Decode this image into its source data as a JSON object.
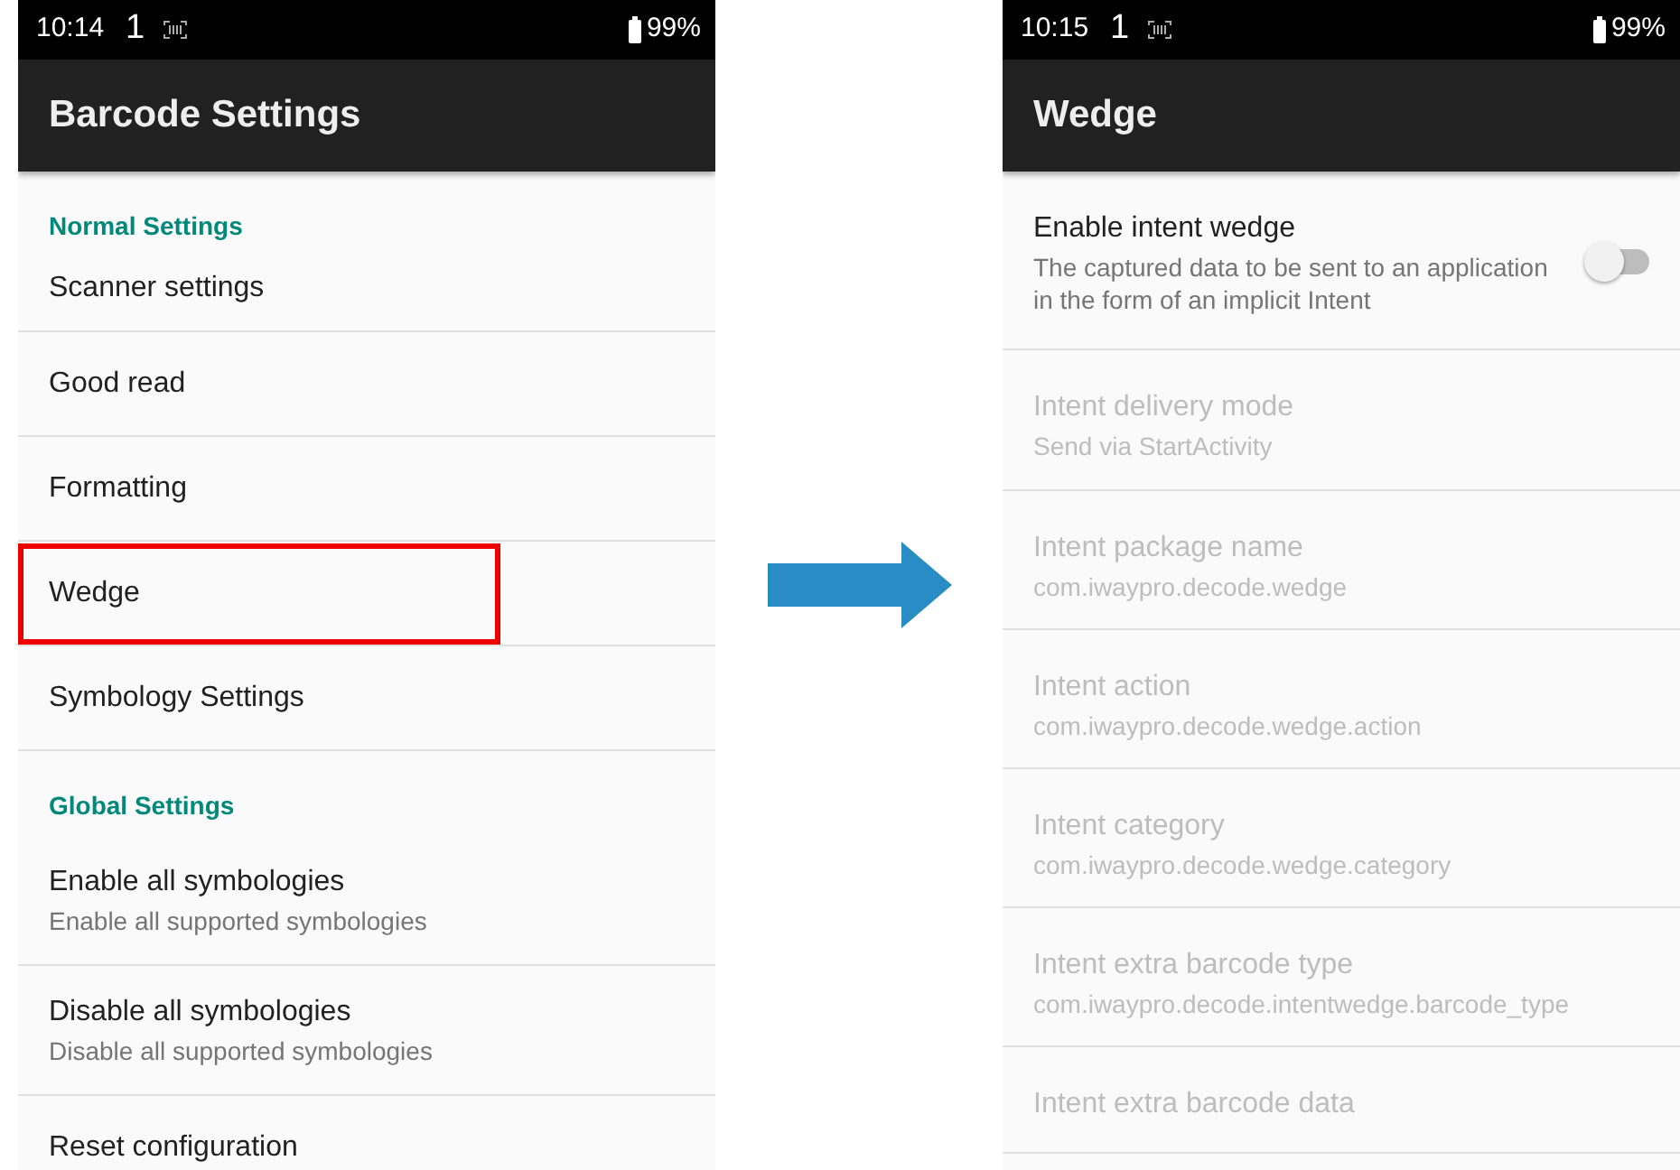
{
  "screens": [
    {
      "status_bar": {
        "time": "10:14",
        "sim": "1",
        "battery": "99%"
      },
      "title": "Barcode Settings",
      "sections": [
        {
          "header": "Normal Settings",
          "items": [
            {
              "title": "Scanner settings",
              "highlighted": false
            },
            {
              "title": "Good read",
              "highlighted": false
            },
            {
              "title": "Formatting",
              "highlighted": false
            },
            {
              "title": "Wedge",
              "highlighted": true
            },
            {
              "title": "Symbology Settings",
              "highlighted": false
            }
          ]
        },
        {
          "header": "Global Settings",
          "items": [
            {
              "title": "Enable all symbologies",
              "summary": "Enable all supported symbologies",
              "highlighted": false
            },
            {
              "title": "Disable all symbologies",
              "summary": "Disable all supported symbologies",
              "highlighted": false
            },
            {
              "title": "Reset configuration",
              "highlighted": false
            }
          ]
        }
      ]
    },
    {
      "status_bar": {
        "time": "10:15",
        "sim": "1",
        "battery": "99%"
      },
      "title": "Wedge",
      "sections": [
        {
          "items": [
            {
              "kind": "toggle",
              "title": "Enable intent wedge",
              "summary": "The captured data to be sent to an application in the form of an implicit Intent",
              "enabled": true,
              "checked": false
            },
            {
              "kind": "text",
              "title": "Intent delivery mode",
              "summary": "Send via StartActivity",
              "enabled": false
            },
            {
              "kind": "text",
              "title": "Intent package name",
              "summary": "com.iwaypro.decode.wedge",
              "enabled": false
            },
            {
              "kind": "text",
              "title": "Intent action",
              "summary": "com.iwaypro.decode.wedge.action",
              "enabled": false
            },
            {
              "kind": "text",
              "title": "Intent category",
              "summary": "com.iwaypro.decode.wedge.category",
              "enabled": false
            },
            {
              "kind": "text",
              "title": "Intent extra barcode type",
              "summary": "com.iwaypro.decode.intentwedge.barcode_type",
              "enabled": false
            },
            {
              "kind": "text",
              "title": "Intent extra barcode data",
              "enabled": false
            }
          ]
        }
      ]
    }
  ]
}
